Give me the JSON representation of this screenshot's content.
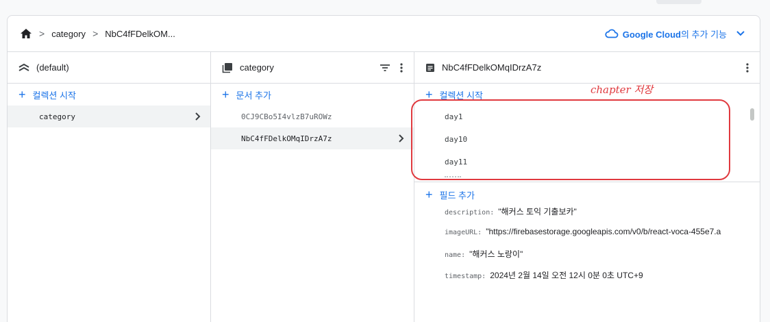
{
  "breadcrumb": {
    "items": [
      "category",
      "NbC4fFDelkOM..."
    ]
  },
  "google_cloud": {
    "brand": "Google Cloud",
    "suffix": "의 추가 기능"
  },
  "col1": {
    "title": "(default)",
    "add_label": "컬렉션 시작",
    "items": [
      "category"
    ]
  },
  "col2": {
    "title": "category",
    "add_label": "문서 추가",
    "items": [
      "0CJ9CBo5I4vlzB7uROWz",
      "NbC4fFDelkOMqIDrzA7z"
    ]
  },
  "col3": {
    "title": "NbC4fFDelkOMqIDrzA7z",
    "add_collection_label": "컬렉션 시작",
    "subcollections": [
      "day1",
      "day10",
      "day11"
    ],
    "add_field_label": "필드 추가",
    "fields": [
      {
        "key": "description:",
        "value": "\"해커스 토익 기출보카\""
      },
      {
        "key": "imageURL:",
        "value": "\"https://firebasestorage.googleapis.com/v0/b/react-voca-455e7.a"
      },
      {
        "key": "name:",
        "value": "\"해커스 노랑이\""
      },
      {
        "key": "timestamp:",
        "value": "2024년 2월 14일 오전 12시 0분 0초 UTC+9"
      }
    ]
  },
  "annotation": {
    "text": "chapter 저장"
  },
  "colors": {
    "accent": "#1a73e8",
    "annotation": "#e0393e",
    "border": "#dadce0"
  }
}
